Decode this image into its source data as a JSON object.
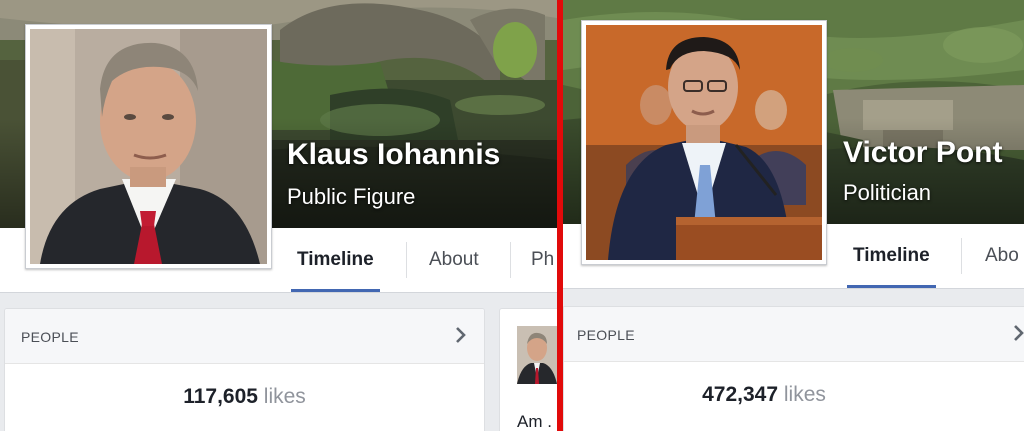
{
  "left_profile": {
    "name": "Klaus Iohannis",
    "category": "Public Figure",
    "tabs": [
      "Timeline",
      "About",
      "Ph"
    ],
    "active_tab": "Timeline",
    "people_card": {
      "title": "PEOPLE",
      "likes_count": "117,605",
      "likes_word": "likes"
    },
    "post_preview": {
      "text": "Am ."
    }
  },
  "right_profile": {
    "name": "Victor Pont",
    "category": "Politician",
    "tabs": [
      "Timeline",
      "Abo"
    ],
    "active_tab": "Timeline",
    "people_card": {
      "title": "PEOPLE",
      "likes_count": "472,347",
      "likes_word": "likes"
    }
  },
  "colors": {
    "divider": "#e10a0a",
    "active_tab_underline": "#4267b2",
    "page_background": "#e9ebee"
  },
  "icons": {
    "chevron": "chevron-right-icon"
  }
}
